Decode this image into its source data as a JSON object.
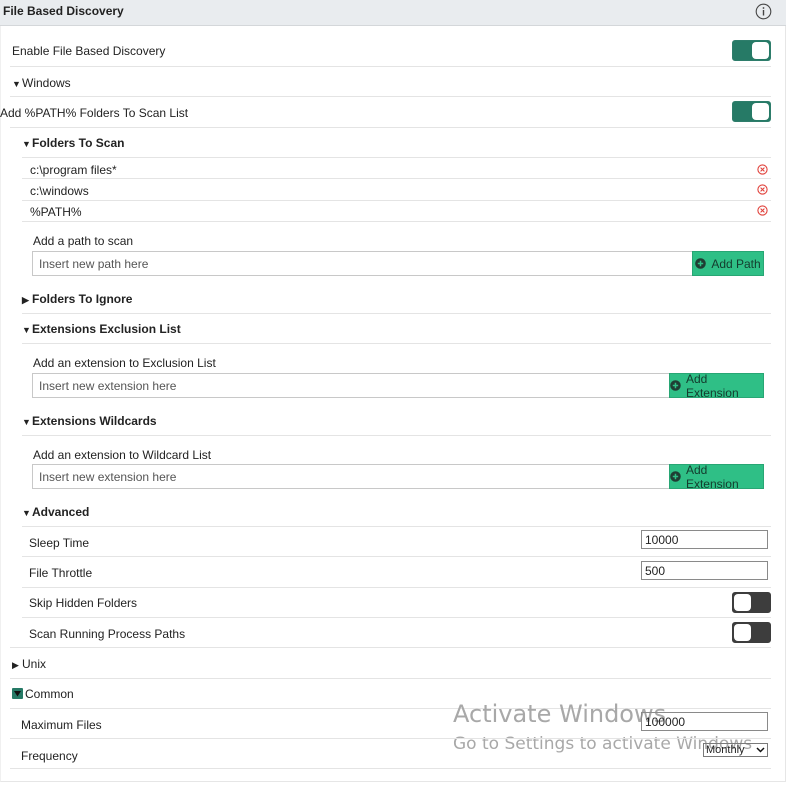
{
  "header": {
    "title": "File Based Discovery",
    "info_icon": "info-circle-icon"
  },
  "enable": {
    "label": "Enable File Based Discovery",
    "state": "on"
  },
  "windows": {
    "label": "Windows",
    "add_path": {
      "label": "Add %PATH% Folders To Scan List",
      "state": "on"
    },
    "folders_to_scan": {
      "label": "Folders To Scan",
      "items": [
        "c:\\program files*",
        "c:\\windows",
        "%PATH%"
      ],
      "add_label": "Add a path to scan",
      "placeholder": "Insert new path here",
      "button": "Add Path"
    },
    "folders_to_ignore": {
      "label": "Folders To Ignore"
    },
    "extensions_exclusion": {
      "label": "Extensions Exclusion List",
      "add_label": "Add an extension to Exclusion List",
      "placeholder": "Insert new extension here",
      "button": "Add Extension"
    },
    "extensions_wildcards": {
      "label": "Extensions Wildcards",
      "add_label": "Add an extension to Wildcard List",
      "placeholder": "Insert new extension here",
      "button": "Add Extension"
    },
    "advanced": {
      "label": "Advanced",
      "sleep_time": {
        "label": "Sleep Time",
        "value": "10000"
      },
      "file_throttle": {
        "label": "File Throttle",
        "value": "500"
      },
      "skip_hidden": {
        "label": "Skip Hidden Folders",
        "state": "off"
      },
      "scan_running": {
        "label": "Scan Running Process Paths",
        "state": "off"
      }
    }
  },
  "unix": {
    "label": "Unix"
  },
  "common": {
    "label": "Common",
    "max_files": {
      "label": "Maximum Files",
      "value": "100000"
    },
    "frequency": {
      "label": "Frequency",
      "value": "Monthly"
    }
  },
  "watermark": {
    "line1": "Activate Windows",
    "line2": "Go to Settings to activate Windows"
  },
  "colors": {
    "toggle_on": "#267a66",
    "toggle_off": "#3d3d3d",
    "button": "#2fbf86",
    "remove": "#e0403a"
  }
}
